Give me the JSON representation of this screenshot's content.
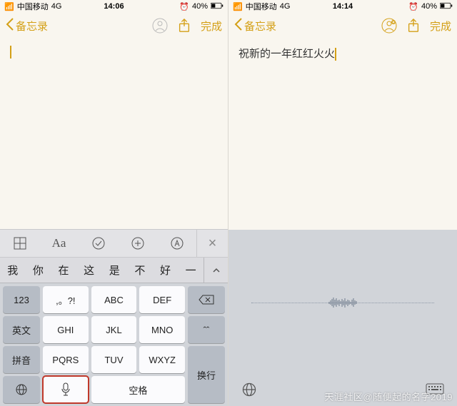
{
  "left": {
    "status": {
      "carrier": "中国移动",
      "network": "4G",
      "time": "14:06",
      "battery": "40%"
    },
    "nav": {
      "back": "备忘录",
      "done": "完成"
    },
    "note_text": "",
    "toolbar": {
      "aa": "Aa"
    },
    "candidates": [
      "我",
      "你",
      "在",
      "这",
      "是",
      "不",
      "好",
      "一"
    ],
    "keys": {
      "r1_func": "123",
      "r1_a": ",。?!",
      "r1_b": "ABC",
      "r1_c": "DEF",
      "r2_func": "英文",
      "r2_a": "GHI",
      "r2_b": "JKL",
      "r2_c": "MNO",
      "r3_func": "拼音",
      "r3_a": "PQRS",
      "r3_b": "TUV",
      "r3_c": "WXYZ",
      "space": "空格",
      "newline": "换行",
      "shift": "ˆˆ"
    }
  },
  "right": {
    "status": {
      "carrier": "中国移动",
      "network": "4G",
      "time": "14:14",
      "battery": "40%"
    },
    "nav": {
      "back": "备忘录",
      "done": "完成"
    },
    "note_text": "祝新的一年红红火火"
  },
  "watermark": "天涯社区@随便起的名字2019"
}
